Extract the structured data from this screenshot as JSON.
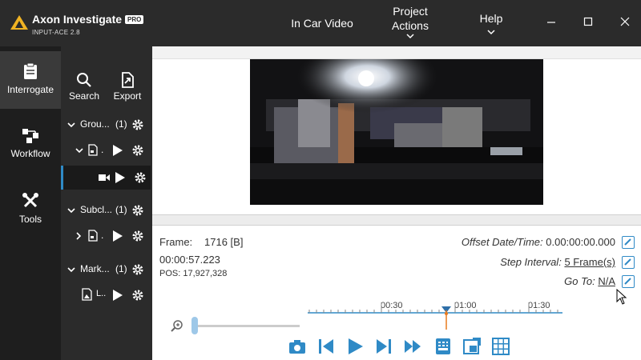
{
  "app": {
    "name": "Axon Investigate",
    "badge": "PRO",
    "subtitle": "INPUT-ACE 2.8"
  },
  "menu": {
    "items": [
      {
        "label": "In Car Video"
      },
      {
        "label": "Project Actions"
      },
      {
        "label": "Help"
      }
    ]
  },
  "window_controls": [
    "minimize-icon",
    "maximize-icon",
    "close-icon"
  ],
  "nav": {
    "items": [
      {
        "label": "Interrogate",
        "icon": "clipboard-icon",
        "active": true
      },
      {
        "label": "Workflow",
        "icon": "workflow-icon",
        "active": false
      },
      {
        "label": "Tools",
        "icon": "tools-icon",
        "active": false
      }
    ]
  },
  "tree": {
    "tools": [
      {
        "label": "Search",
        "icon": "search-icon"
      },
      {
        "label": "Export",
        "icon": "export-icon"
      }
    ],
    "groups_label": "Grou...",
    "groups_count": "(1)",
    "subclips_label": "Subcl...",
    "subclips_count": "(1)",
    "markers_label": "Mark...",
    "markers_count": "(1)",
    "marker_item_label": "L.."
  },
  "info": {
    "frame_label": "Frame:",
    "frame_value": "1716 [B]",
    "time": "00:00:57.223",
    "pos": "POS: 17,927,328",
    "offset_label": "Offset Date/Time:",
    "offset_value": "0.00:00:00.000",
    "step_label": "Step Interval:",
    "step_value": "5 Frame(s)",
    "goto_label": "Go To:",
    "goto_value": "N/A"
  },
  "timeline": {
    "ticks": [
      "00:30",
      "01:00",
      "01:30"
    ],
    "playhead_seconds": 57.2
  },
  "colors": {
    "accent": "#2f8ac6",
    "titlebar": "#2b2b2b",
    "playhead": "#e87a1e"
  }
}
